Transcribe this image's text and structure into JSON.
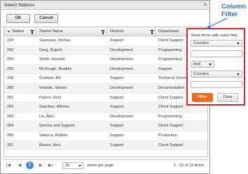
{
  "dialog": {
    "title": "Select Stations",
    "close_glyph": "×",
    "ok_label": "OK",
    "cancel_label": "Cancel"
  },
  "grid": {
    "columns": [
      "Station",
      "Station Name",
      "Division",
      "Department"
    ],
    "sort_glyph": "▲",
    "rows": [
      {
        "station": "224",
        "name": "Swanson, Joshua",
        "division": "Support",
        "department": "Client Support"
      },
      {
        "station": "250",
        "name": "Garg, Rajesh",
        "division": "Development",
        "department": "Programming"
      },
      {
        "station": "256",
        "name": "Smith, Samuel",
        "division": "Development",
        "department": "Programming"
      },
      {
        "station": "256",
        "name": "McGough, Bradley",
        "division": "Development",
        "department": "Support"
      },
      {
        "station": "258",
        "name": "Graham, Bill",
        "division": "Support",
        "department": "Technical Service"
      },
      {
        "station": "280",
        "name": "Velarde, Steven",
        "division": "Development",
        "department": "Documentation"
      },
      {
        "station": "281",
        "name": "Parker, Vicki",
        "division": "Support",
        "department": "Client Support"
      },
      {
        "station": "282",
        "name": "Sanchez, Alfonso",
        "division": "Support",
        "department": "Client Support"
      },
      {
        "station": "283",
        "name": "Lin, Alex",
        "division": "Development",
        "department": "Programming"
      },
      {
        "station": "284",
        "name": "Service and Support",
        "division": "Support",
        "department": "Client Support"
      },
      {
        "station": "285",
        "name": "Valance, Robbie",
        "division": "Support",
        "department": "Production"
      },
      {
        "station": "287",
        "name": "Mauss, Alex",
        "division": "Support",
        "department": "Client Support"
      }
    ]
  },
  "pager": {
    "first_glyph": "|◀",
    "prev_glyph": "◀",
    "current_page": "1",
    "next_glyph": "▶",
    "last_glyph": "▶|",
    "page_size": "25",
    "page_size_label": "items per page",
    "info": "1 - 12 of 12 items"
  },
  "filter_popup": {
    "label": "Show items with value that",
    "operator1": "Contains",
    "logic": "And",
    "operator2": "Contains",
    "filter_label": "Filter",
    "clear_label": "Clear"
  },
  "annotation": {
    "line1": "Column",
    "line2": "Filter"
  },
  "colors": {
    "accent_blue": "#3a8ee6",
    "filter_button": "#f06a1e",
    "highlight_border": "#e0262b",
    "annotation_text": "#2a6fd6"
  }
}
